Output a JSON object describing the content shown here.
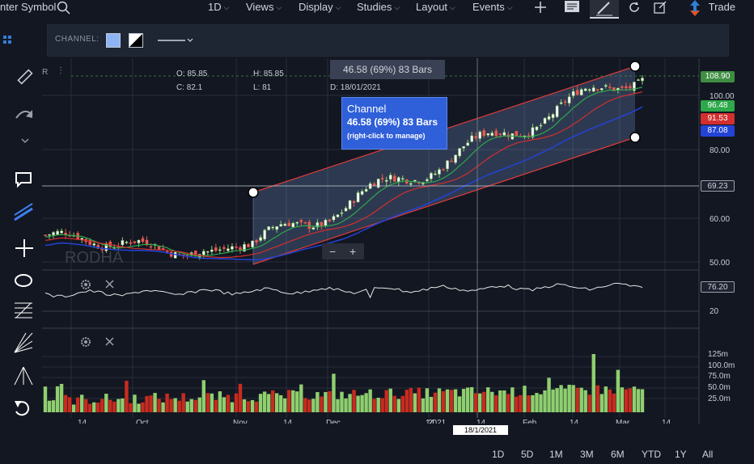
{
  "topbar": {
    "symbol_search": "nter Symbol",
    "interval": "1D",
    "views": "Views",
    "display": "Display",
    "studies": "Studies",
    "layout": "Layout",
    "events": "Events",
    "trade": "Trade"
  },
  "channel_bar": {
    "label": "CHANNEL:",
    "fill_color": "#8fb4f5",
    "line_style": "solid"
  },
  "ohlc": {
    "o_label": "O:",
    "o": "85.85",
    "h_label": "H:",
    "h": "85.85",
    "c_label": "C:",
    "c": "82.1",
    "l_label": "L:",
    "l": "81",
    "d_label": "D:",
    "d": "18/01/2021"
  },
  "measure_label": "46.58 (69%) 83 Bars",
  "tooltip": {
    "title": "Channel",
    "value": "46.58 (69%) 83 Bars",
    "hint": "(right-click to manage)"
  },
  "watermark": "RODHA",
  "price_axis": {
    "ticks": [
      "100.00",
      "80.00",
      "60.00",
      "50.00"
    ],
    "badges": [
      {
        "value": "108.90",
        "color": "#3e8e41"
      },
      {
        "value": "96.48",
        "color": "#2ea84a"
      },
      {
        "value": "91.53",
        "color": "#d32f2f"
      },
      {
        "value": "87.08",
        "color": "#2343d6"
      },
      {
        "value": "69.23",
        "color": "#1e2230"
      }
    ]
  },
  "oscillator": {
    "badge": "76.20",
    "tick": "20"
  },
  "volume_axis": {
    "ticks": [
      "125m",
      "100.0m",
      "75.0m",
      "50.0m",
      "25.0m"
    ]
  },
  "time_axis": {
    "labels": [
      "14",
      "Oct",
      "Nov",
      "14",
      "Dec",
      "14",
      "2021",
      "14",
      "Feb",
      "14",
      "Mar",
      "14"
    ],
    "crosshair_date": "18/1/2021"
  },
  "range_buttons": [
    "1D",
    "5D",
    "1M",
    "3M",
    "6M",
    "YTD",
    "1Y",
    "All"
  ],
  "zoom": {
    "minus": "−",
    "plus": "+"
  },
  "chart_data": {
    "type": "candlestick",
    "price_range": [
      46,
      112
    ],
    "series": [
      {
        "name": "",
        "color": "#2ea84a"
      },
      {
        "name": "",
        "color": "#d32f2f"
      },
      {
        "name": "",
        "color": "#2343d6"
      }
    ]
  }
}
